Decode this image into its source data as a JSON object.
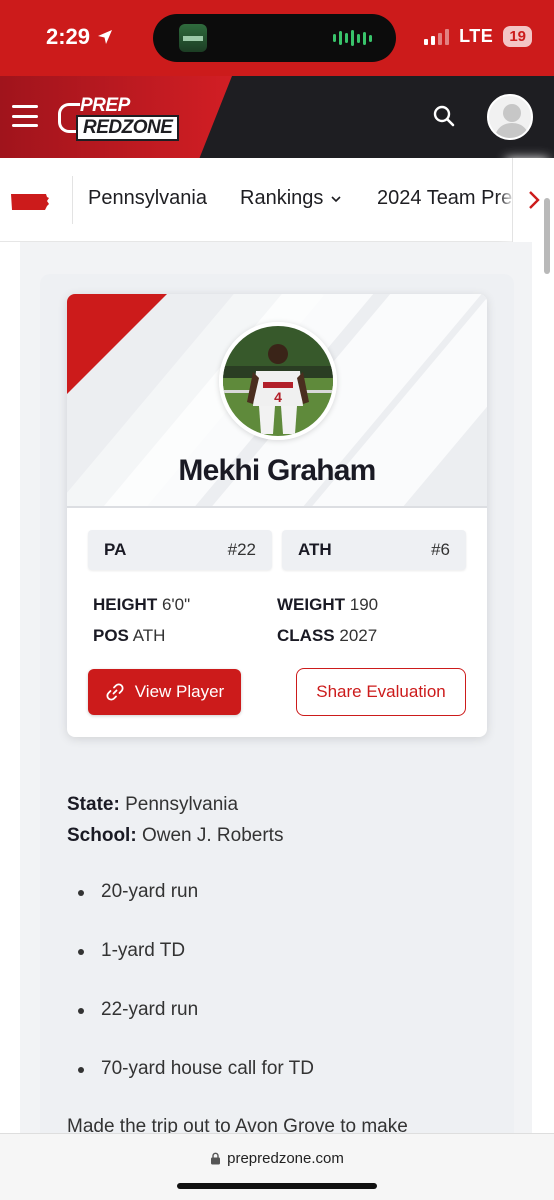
{
  "status_bar": {
    "time": "2:29",
    "network": "LTE",
    "battery": "19"
  },
  "header": {
    "logo_line1": "PREP",
    "logo_line2": "REDZONE"
  },
  "nav": {
    "state": "Pennsylvania",
    "rankings": "Rankings",
    "team_preview": "2024 Team Pre"
  },
  "player": {
    "name": "Mekhi Graham",
    "state_rank_label": "PA",
    "state_rank": "#22",
    "pos_rank_label": "ATH",
    "pos_rank": "#6",
    "height_label": "HEIGHT",
    "height": "6'0\"",
    "weight_label": "WEIGHT",
    "weight": "190",
    "pos_label": "POS",
    "pos": "ATH",
    "class_label": "CLASS",
    "class": "2027",
    "view_button": "View Player",
    "share_button": "Share Evaluation"
  },
  "article": {
    "state_label": "State:",
    "state": "Pennsylvania",
    "school_label": "School:",
    "school": "Owen J. Roberts",
    "bullets": [
      "20-yard run",
      "1-yard TD",
      "22-yard run",
      "70-yard house call for TD"
    ],
    "trailing_text": "Made the trip out to Avon Grove to make"
  },
  "browser": {
    "url": "prepredzone.com"
  },
  "colors": {
    "brand_red": "#cc1b1b",
    "header_dark": "#1e1e22",
    "panel_bg": "#eef0f3"
  }
}
